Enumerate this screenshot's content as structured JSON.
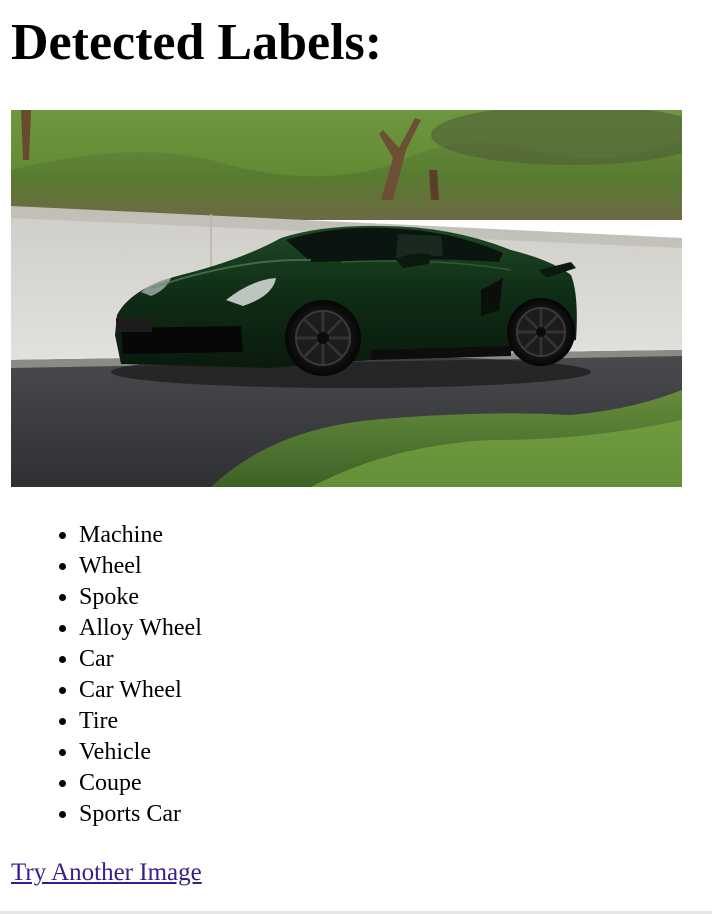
{
  "page": {
    "heading": "Detected Labels:",
    "labels": [
      "Machine",
      "Wheel",
      "Spoke",
      "Alloy Wheel",
      "Car",
      "Car Wheel",
      "Tire",
      "Vehicle",
      "Coupe",
      "Sports Car"
    ],
    "try_another_label": "Try Another Image"
  },
  "colors": {
    "link": "#3a1d8a",
    "car_body": "#0f2a14",
    "grass": "#4f7a2c",
    "road": "#3a3b3d",
    "wall": "#d6d5d1"
  }
}
